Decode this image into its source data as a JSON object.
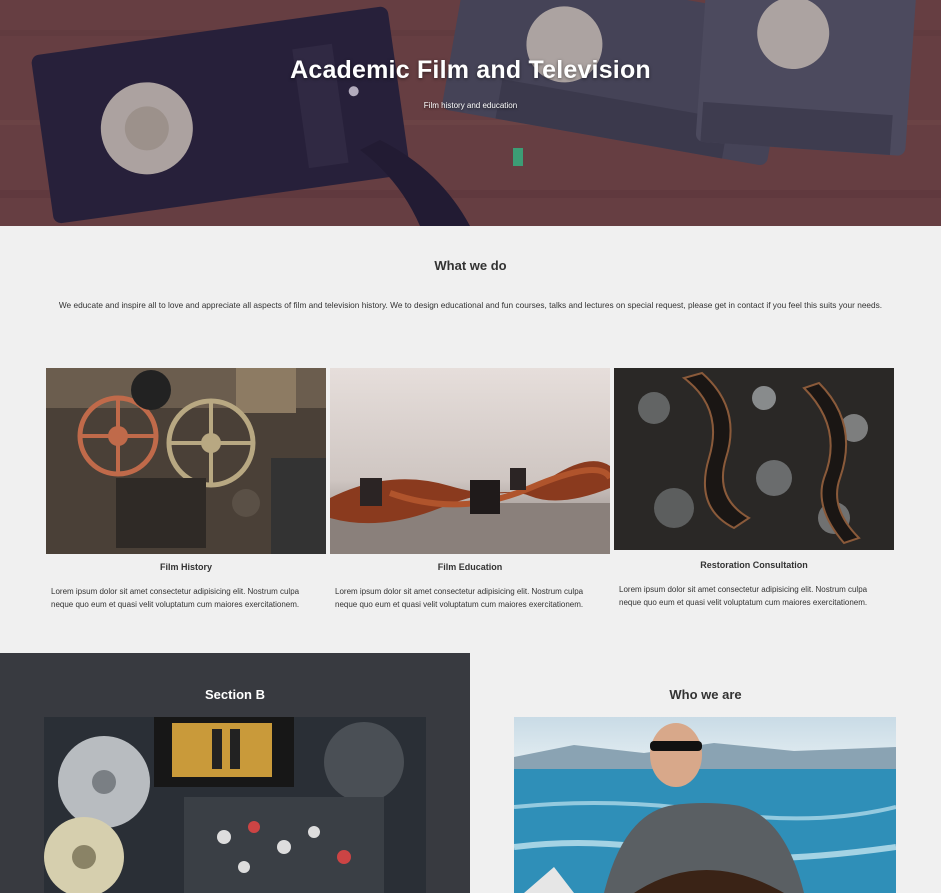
{
  "hero": {
    "title": "Academic Film and Television",
    "subtitle": "Film history and education"
  },
  "what_we_do": {
    "title": "What we do",
    "text": "We educate and inspire all to love and appreciate all aspects of film and television history. We to design educational and fun courses, talks and lectures on special request, please get in contact if you feel this suits your needs."
  },
  "cards": [
    {
      "title": "Film History",
      "text": "Lorem ipsum dolor sit amet consectetur adipisicing elit. Nostrum culpa neque quo eum et quasi velit voluptatum cum maiores exercitationem.",
      "image": "film-projector-reels-image"
    },
    {
      "title": "Film Education",
      "text": "Lorem ipsum dolor sit amet consectetur adipisicing elit. Nostrum culpa neque quo eum et quasi velit voluptatum cum maiores exercitationem.",
      "image": "film-strip-canisters-image"
    },
    {
      "title": "Restoration Consultation",
      "text": "Lorem ipsum dolor sit amet consectetur adipisicing elit. Nostrum culpa neque quo eum et quasi velit voluptatum cum maiores exercitationem.",
      "image": "film-strip-bokeh-image"
    }
  ],
  "section_b": {
    "title": "Section B",
    "image": "film-editing-equipment-image"
  },
  "who_we_are": {
    "title": "Who we are",
    "image": "man-on-boat-image"
  },
  "colors": {
    "background": "#f0f0f0",
    "dark_section": "#383a40",
    "text": "#333333",
    "hero_text": "#ffffff"
  }
}
